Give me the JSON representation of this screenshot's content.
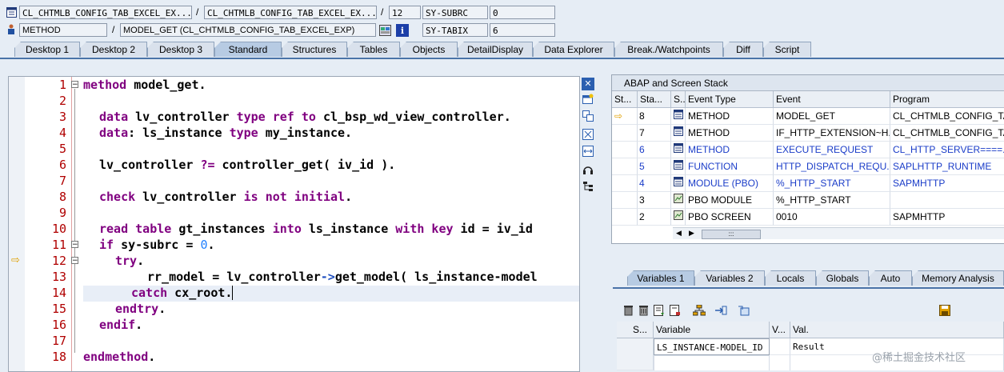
{
  "header": {
    "row1": {
      "program": "CL_CHTMLB_CONFIG_TAB_EXCEL_EX...",
      "include": "CL_CHTMLB_CONFIG_TAB_EXCEL_EX...",
      "line": "12",
      "sysfield_name": "SY-SUBRC",
      "sysfield_value": "0"
    },
    "row2": {
      "event_type": "METHOD",
      "event": "MODEL_GET (CL_CHTMLB_CONFIG_TAB_EXCEL_EXP)",
      "sysfield_name": "SY-TABIX",
      "sysfield_value": "6"
    },
    "separator": "/"
  },
  "tabs": [
    {
      "label": "Desktop 1"
    },
    {
      "label": "Desktop 2"
    },
    {
      "label": "Desktop 3"
    },
    {
      "label": "Standard"
    },
    {
      "label": "Structures"
    },
    {
      "label": "Tables"
    },
    {
      "label": "Objects"
    },
    {
      "label": "DetailDisplay"
    },
    {
      "label": "Data Explorer"
    },
    {
      "label": "Break./Watchpoints"
    },
    {
      "label": "Diff"
    },
    {
      "label": "Script"
    }
  ],
  "editor": {
    "line_numbers": [
      "1",
      "2",
      "3",
      "4",
      "5",
      "6",
      "7",
      "8",
      "9",
      "10",
      "11",
      "12",
      "13",
      "14",
      "15",
      "16",
      "17",
      "18"
    ],
    "current_line_marker": "⇨"
  },
  "stack": {
    "title": "ABAP and Screen Stack",
    "columns": [
      "St...",
      "Sta...",
      "S...",
      "Event Type",
      "Event",
      "Program"
    ],
    "rows": [
      {
        "level": "8",
        "type": "METHOD",
        "event": "MODEL_GET",
        "program": "CL_CHTMLB_CONFIG_TA...",
        "current": true
      },
      {
        "level": "7",
        "type": "METHOD",
        "event": "IF_HTTP_EXTENSION~H...",
        "program": "CL_CHTMLB_CONFIG_TA..."
      },
      {
        "level": "6",
        "type": "METHOD",
        "event": "EXECUTE_REQUEST",
        "program": "CL_HTTP_SERVER====..."
      },
      {
        "level": "5",
        "type": "FUNCTION",
        "event": "HTTP_DISPATCH_REQU...",
        "program": "SAPLHTTP_RUNTIME"
      },
      {
        "level": "4",
        "type": "MODULE (PBO)",
        "event": "%_HTTP_START",
        "program": "SAPMHTTP"
      },
      {
        "level": "3",
        "type": "PBO MODULE",
        "event": "%_HTTP_START",
        "program": ""
      },
      {
        "level": "2",
        "type": "PBO SCREEN",
        "event": "0010",
        "program": "SAPMHTTP"
      }
    ],
    "scroll_thumb": ":::"
  },
  "vartabs": [
    {
      "label": "Variables 1"
    },
    {
      "label": "Variables 2"
    },
    {
      "label": "Locals"
    },
    {
      "label": "Globals"
    },
    {
      "label": "Auto"
    },
    {
      "label": "Memory Analysis"
    }
  ],
  "variables": {
    "columns": [
      "S...",
      "Variable",
      "V...",
      "Val."
    ],
    "rows": [
      {
        "name": "LS_INSTANCE-MODEL_ID",
        "value": "Result"
      }
    ]
  },
  "watermark": "@稀土掘金技术社区"
}
